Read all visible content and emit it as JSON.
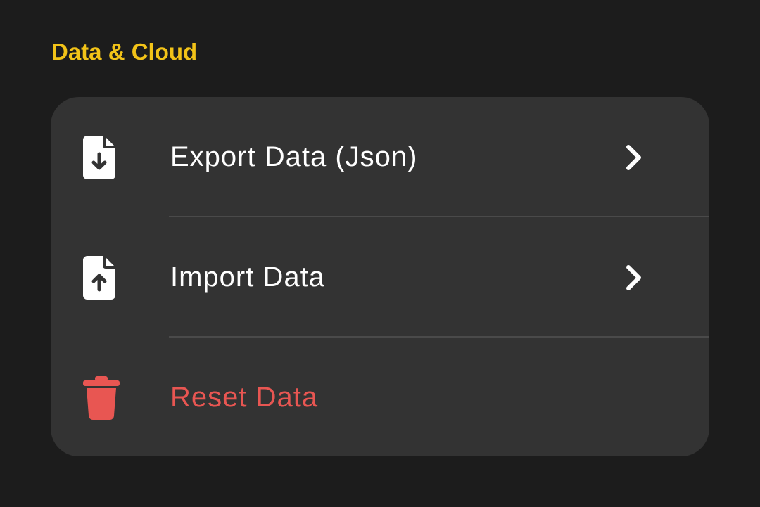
{
  "section": {
    "title": "Data & Cloud"
  },
  "items": [
    {
      "label": "Export Data (Json)",
      "icon": "file-download-icon",
      "has_chevron": true
    },
    {
      "label": "Import Data",
      "icon": "file-upload-icon",
      "has_chevron": true
    },
    {
      "label": "Reset Data",
      "icon": "trash-icon",
      "has_chevron": false
    }
  ],
  "colors": {
    "background": "#1c1c1c",
    "card": "#333333",
    "accent": "#f2c318",
    "text": "#ffffff",
    "danger": "#e85652",
    "divider": "#4a4a4a"
  }
}
